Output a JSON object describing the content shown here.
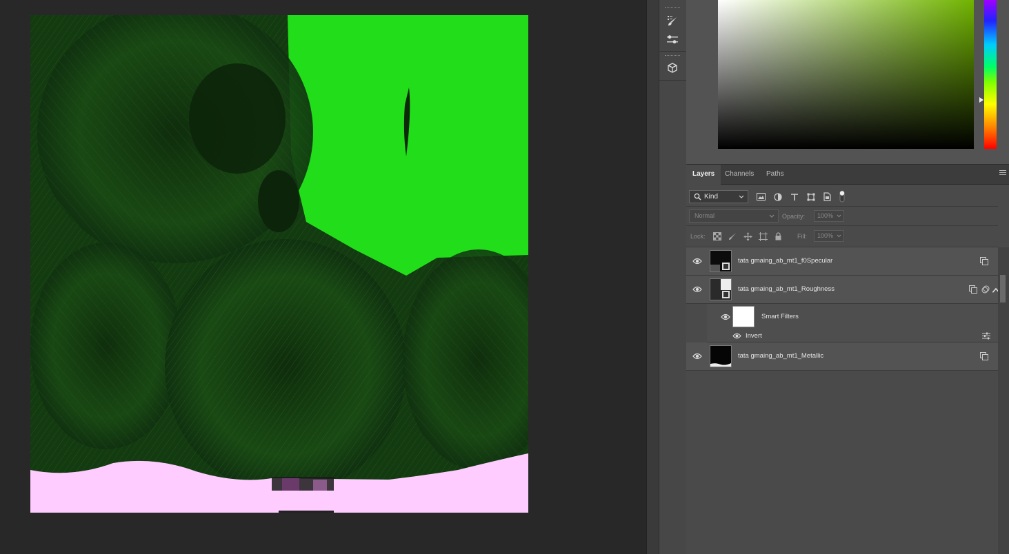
{
  "colors": {
    "canvas_green": "#22dd1a",
    "canvas_dark": "#133a10",
    "canvas_pink": "#ffccff",
    "panel_bg": "#4a4a4a",
    "selected_hue": "#70b300"
  },
  "dock": {
    "icons": [
      "brush-presets-icon",
      "adjustments-icon",
      "3d-cube-icon"
    ]
  },
  "layers_panel": {
    "tabs": [
      {
        "label": "Layers",
        "active": true
      },
      {
        "label": "Channels",
        "active": false
      },
      {
        "label": "Paths",
        "active": false
      }
    ],
    "filter": {
      "kind_label": "Kind",
      "icons": [
        "pixel-filter-icon",
        "adjustment-filter-icon",
        "type-filter-icon",
        "shape-filter-icon",
        "smart-object-filter-icon"
      ]
    },
    "blend_mode": "Normal",
    "opacity_label": "Opacity:",
    "opacity_value": "100%",
    "lock_label": "Lock:",
    "fill_label": "Fill:",
    "fill_value": "100%",
    "layers": [
      {
        "name": "tata gmaing_ab_mt1_f0Specular",
        "visible": true
      },
      {
        "name": "tata gmaing_ab_mt1_Roughness",
        "visible": true,
        "smart_filters": {
          "label": "Smart Filters",
          "filters": [
            {
              "name": "Invert"
            }
          ]
        }
      },
      {
        "name": "tata gmaing_ab_mt1_Metallic",
        "visible": true
      }
    ]
  }
}
